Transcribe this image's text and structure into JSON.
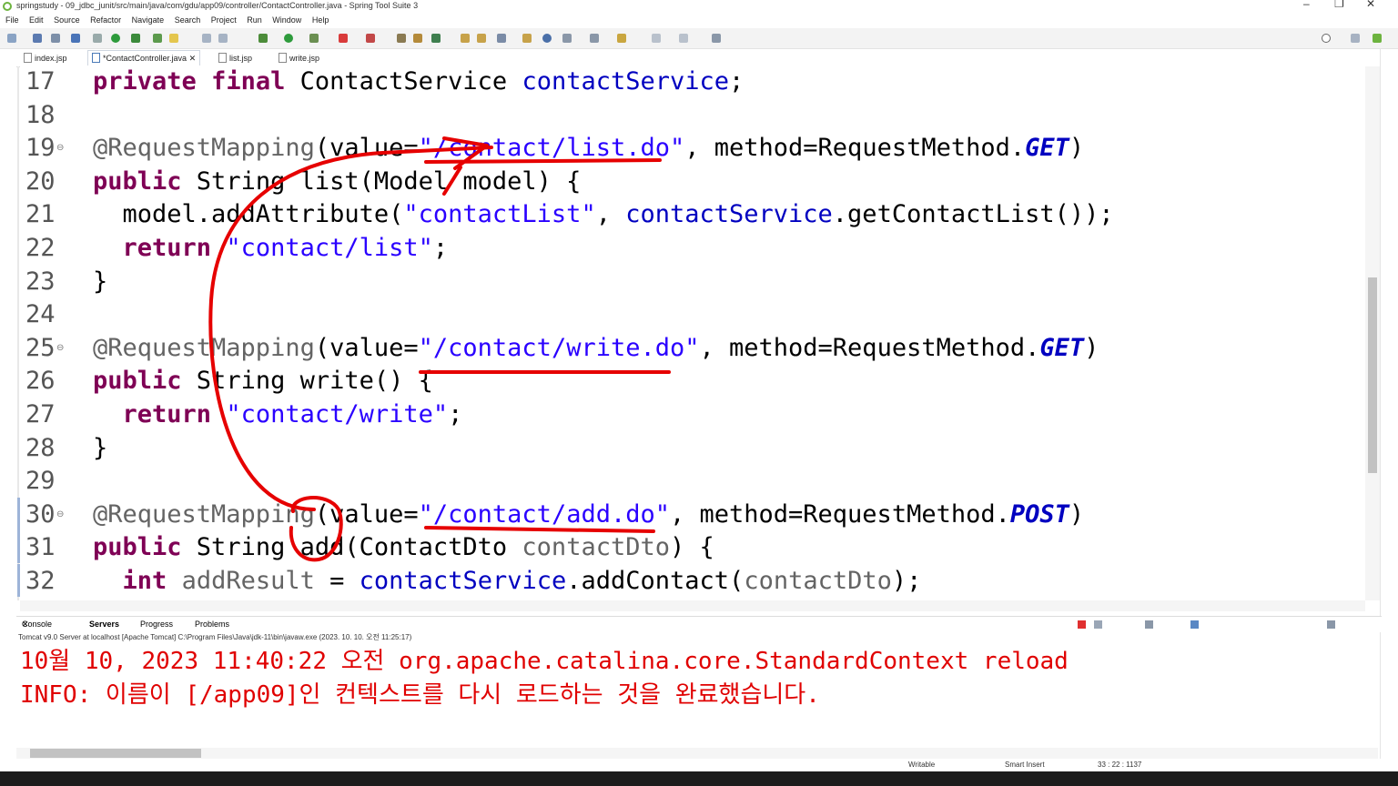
{
  "window": {
    "title": "springstudy - 09_jdbc_junit/src/main/java/com/gdu/app09/controller/ContactController.java - Spring Tool Suite 3",
    "controls": [
      "–",
      "❐",
      "✕"
    ]
  },
  "menu": [
    "File",
    "Edit",
    "Source",
    "Refactor",
    "Navigate",
    "Search",
    "Project",
    "Run",
    "Window",
    "Help"
  ],
  "tabs": [
    {
      "label": "index.jsp"
    },
    {
      "label": "*ContactController.java",
      "close": "✕"
    },
    {
      "label": "list.jsp"
    },
    {
      "label": "write.jsp"
    }
  ],
  "editor": {
    "lines": [
      {
        "num": "17",
        "fold": "",
        "parts": [
          [
            "kw",
            "private"
          ],
          [
            "t",
            " "
          ],
          [
            "kw",
            "final"
          ],
          [
            "t",
            " ContactService "
          ],
          [
            "fld",
            "contactService"
          ],
          [
            "t",
            ";"
          ]
        ]
      },
      {
        "num": "18",
        "fold": "",
        "parts": []
      },
      {
        "num": "19",
        "fold": "⊖",
        "parts": [
          [
            "ann",
            "@RequestMapping"
          ],
          [
            "t",
            "(value="
          ],
          [
            "str",
            "\"/contact/list.do\""
          ],
          [
            "t",
            ", method=RequestMethod."
          ],
          [
            "ital",
            "GET"
          ],
          [
            "t",
            ")"
          ]
        ]
      },
      {
        "num": "20",
        "fold": "",
        "parts": [
          [
            "kw",
            "public"
          ],
          [
            "t",
            " String list(Model model) {"
          ]
        ]
      },
      {
        "num": "21",
        "fold": "",
        "parts": [
          [
            "t",
            "  model.addAttribute("
          ],
          [
            "str",
            "\"contactList\""
          ],
          [
            "t",
            ", "
          ],
          [
            "fld",
            "contactService"
          ],
          [
            "t",
            ".getContactList());"
          ]
        ]
      },
      {
        "num": "22",
        "fold": "",
        "parts": [
          [
            "t",
            "  "
          ],
          [
            "kw",
            "return"
          ],
          [
            "t",
            " "
          ],
          [
            "str",
            "\"contact/list\""
          ],
          [
            "t",
            ";"
          ]
        ]
      },
      {
        "num": "23",
        "fold": "",
        "parts": [
          [
            "t",
            "}"
          ]
        ]
      },
      {
        "num": "24",
        "fold": "",
        "parts": []
      },
      {
        "num": "25",
        "fold": "⊖",
        "parts": [
          [
            "ann",
            "@RequestMapping"
          ],
          [
            "t",
            "(value="
          ],
          [
            "str",
            "\"/contact/write.do\""
          ],
          [
            "t",
            ", method=RequestMethod."
          ],
          [
            "ital",
            "GET"
          ],
          [
            "t",
            ")"
          ]
        ]
      },
      {
        "num": "26",
        "fold": "",
        "parts": [
          [
            "kw",
            "public"
          ],
          [
            "t",
            " String write() {"
          ]
        ]
      },
      {
        "num": "27",
        "fold": "",
        "parts": [
          [
            "t",
            "  "
          ],
          [
            "kw",
            "return"
          ],
          [
            "t",
            " "
          ],
          [
            "str",
            "\"contact/write\""
          ],
          [
            "t",
            ";"
          ]
        ]
      },
      {
        "num": "28",
        "fold": "",
        "parts": [
          [
            "t",
            "}"
          ]
        ]
      },
      {
        "num": "29",
        "fold": "",
        "parts": []
      },
      {
        "num": "30",
        "fold": "⊖",
        "parts": [
          [
            "ann",
            "@RequestMapping"
          ],
          [
            "t",
            "(value="
          ],
          [
            "str",
            "\"/contact/add.do\""
          ],
          [
            "t",
            ", method=RequestMethod."
          ],
          [
            "ital",
            "POST"
          ],
          [
            "t",
            ")"
          ]
        ]
      },
      {
        "num": "31",
        "fold": "",
        "parts": [
          [
            "kw",
            "public"
          ],
          [
            "t",
            " String add(ContactDto "
          ],
          [
            "ann",
            "contactDto"
          ],
          [
            "t",
            ") {"
          ]
        ]
      },
      {
        "num": "32",
        "fold": "",
        "parts": [
          [
            "t",
            "  "
          ],
          [
            "kw",
            "int"
          ],
          [
            "t",
            " "
          ],
          [
            "ann",
            "addResult"
          ],
          [
            "t",
            " = "
          ],
          [
            "fld",
            "contactService"
          ],
          [
            "t",
            ".addContact("
          ],
          [
            "ann",
            "contactDto"
          ],
          [
            "t",
            ");"
          ]
        ]
      }
    ]
  },
  "console": {
    "tabs": [
      "Console",
      "Servers",
      "Progress",
      "Problems"
    ],
    "description": "Tomcat v9.0 Server at localhost [Apache Tomcat] C:\\Program Files\\Java\\jdk-11\\bin\\javaw.exe  (2023. 10. 10. 오전 11:25:17)",
    "lines": [
      "10월 10, 2023 11:40:22 오전 org.apache.catalina.core.StandardContext reload",
      "INFO: 이름이 [/app09]인 컨텍스트를 다시 로드하는 것을 완료했습니다."
    ]
  },
  "status": {
    "mode": "Writable",
    "insert": "Smart Insert",
    "position": "33 : 22 : 1137"
  },
  "colors": {
    "keyword": "#7f0055",
    "string": "#2a00ff",
    "field": "#0000c0",
    "annotation": "#646464",
    "console_error": "#e00000",
    "ink": "#e60000"
  }
}
